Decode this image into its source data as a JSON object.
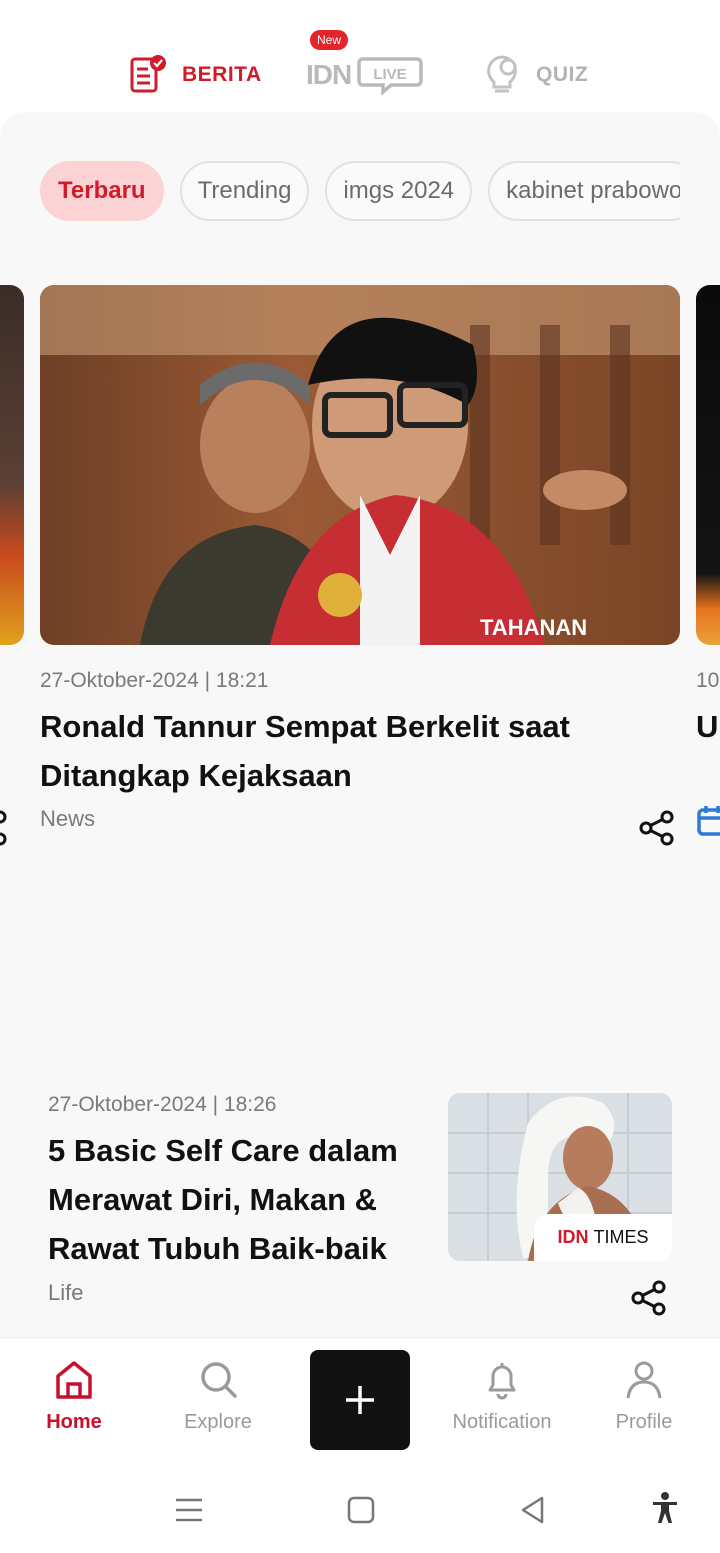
{
  "top_tabs": {
    "berita": "BERITA",
    "new_badge": "New",
    "idn": "IDN",
    "live": "LIVE",
    "quiz": "QUIZ",
    "icons": [
      "news-check-icon",
      "bulb-icon"
    ],
    "active_color": "#d11b2b",
    "inactive_color": "#b3b3b3"
  },
  "chips": [
    {
      "label": "Terbaru",
      "active": true
    },
    {
      "label": "Trending",
      "active": false
    },
    {
      "label": "imgs 2024",
      "active": false
    },
    {
      "label": "kabinet prabowo",
      "active": false
    }
  ],
  "carousel": {
    "dots_total": 6,
    "dot_active_index": 1,
    "hero": {
      "date": "27-Oktober-2024 | 18:21",
      "title": "Ronald Tannur Sempat Berkelit saat Ditangkap Kejaksaan",
      "category": "News",
      "image_text": "TAHANAN"
    },
    "next_card": {
      "date": "10",
      "title": "U"
    }
  },
  "article2": {
    "date": "27-Oktober-2024 | 18:26",
    "title": "5 Basic Self Care dalam Merawat Diri, Makan & Rawat Tubuh Baik-baik",
    "category": "Life",
    "badge_idn": "IDN",
    "badge_times": "TIMES"
  },
  "bottom_nav": {
    "home": "Home",
    "explore": "Explore",
    "notification": "Notification",
    "profile": "Profile",
    "active": "home",
    "active_color": "#c8102e"
  },
  "system_nav": [
    "menu-icon",
    "home-square-icon",
    "back-icon",
    "accessibility-icon"
  ]
}
